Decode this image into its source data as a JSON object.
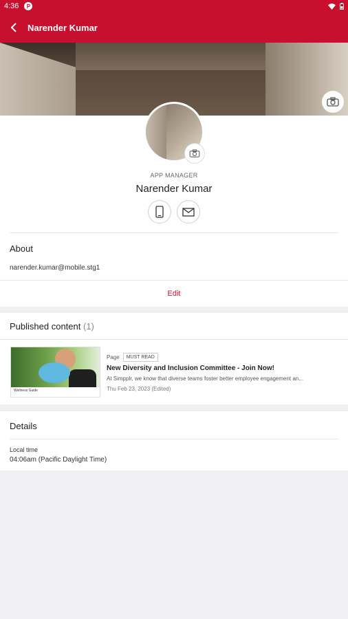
{
  "status_bar": {
    "time": "4:36",
    "app_badge": "P"
  },
  "app_bar": {
    "title": "Narender Kumar"
  },
  "profile": {
    "role": "APP MANAGER",
    "name": "Narender Kumar"
  },
  "about": {
    "title": "About",
    "email": "narender.kumar@mobile.stg1",
    "edit_label": "Edit"
  },
  "published": {
    "title": "Published content",
    "count": "(1)",
    "items": [
      {
        "type": "Page",
        "badge": "MUST READ",
        "headline": "New Diversity and Inclusion Committee - Join Now!",
        "excerpt": "At Simpplr, we know that diverse teams foster better employee engagement an...",
        "date": "Thu Feb 23, 2023 (Edited)",
        "thumb_caption": "Wellness Guide"
      }
    ]
  },
  "details": {
    "title": "Details",
    "local_time_label": "Local time",
    "local_time_value": "04:06am (Pacific Daylight Time)"
  },
  "colors": {
    "brand": "#c8102e",
    "background": "#f0f0f2"
  }
}
